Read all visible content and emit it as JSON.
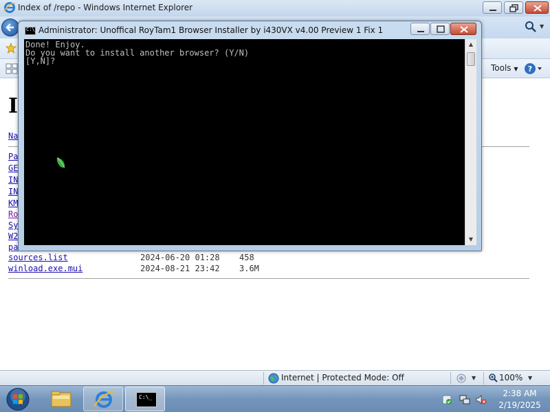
{
  "ie": {
    "window_title": "Index of /repo - Windows Internet Explorer",
    "tools_label": "Tools",
    "tools_arrow": "▼",
    "search_arrow": "▼",
    "page": {
      "heading_visible": "I",
      "name_header_visible": "Na",
      "partial_rows": [
        "Pa",
        "GE",
        "IN",
        "IN",
        "KM",
        "Ro",
        "Sy",
        "W2",
        "pa"
      ],
      "files": [
        {
          "name": "sources.list",
          "date": "2024-06-20 01:28",
          "size": "458"
        },
        {
          "name": "winload.exe.mui",
          "date": "2024-08-21 23:42",
          "size": "3.6M"
        }
      ]
    },
    "status": {
      "zone_text": "Internet | Protected Mode: Off",
      "zoom_text": "100%",
      "dropdown_arrow": "▼"
    }
  },
  "console": {
    "title": "Administrator:  Unoffical RoyTam1 Browser Installer by i430VX v4.00 Preview 1 Fix 1",
    "icon_text": "C:\\_",
    "lines": "Done! Enjoy.\nDo you want to install another browser? (Y/N)\n[Y,N]?",
    "scroll_up": "▲",
    "scroll_down": "▼"
  },
  "taskbar": {
    "time": "2:38 AM",
    "date": "2/19/2025",
    "cmd_icon_text": "C:\\_"
  }
}
